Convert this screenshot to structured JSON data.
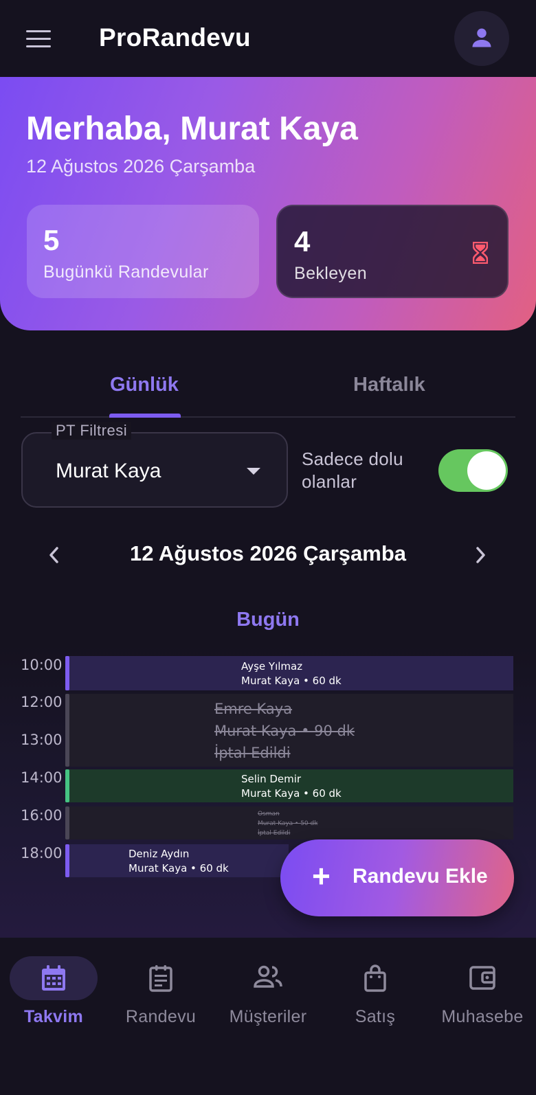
{
  "app": {
    "title": "ProRandevu",
    "menu_icon": "hamburger-menu-icon",
    "profile_icon": "person-icon"
  },
  "hero": {
    "greeting": "Merhaba, Murat Kaya",
    "date": "12 Ağustos 2026 Çarşamba",
    "stats": [
      {
        "value": "5",
        "label": "Bugünkü Randevular"
      },
      {
        "value": "4",
        "label": "Bekleyen",
        "icon": "hourglass-icon"
      }
    ]
  },
  "tabs": [
    {
      "label": "Günlük",
      "active": true
    },
    {
      "label": "Haftalık",
      "active": false
    }
  ],
  "filter": {
    "legend": "PT Filtresi",
    "value": "Murat Kaya"
  },
  "toggle": {
    "label": "Sadece dolu olanlar",
    "on": true
  },
  "date_nav": {
    "date": "12 Ağustos 2026 Çarşamba",
    "today_label": "Bugün"
  },
  "calendar": {
    "times": [
      "10:00",
      "12:00",
      "13:00",
      "14:00",
      "16:00",
      "18:00"
    ],
    "events": [
      {
        "name": "Ayşe Yılmaz",
        "detail": "Murat Kaya • 60 dk",
        "status": ""
      },
      {
        "name": "Emre Kaya",
        "detail": "Murat Kaya • 90 dk",
        "status": "İptal Edildi"
      },
      {
        "name": "Selin Demir",
        "detail": "Murat Kaya • 60 dk",
        "status": ""
      },
      {
        "name": "Osman",
        "detail": "Murat Kaya • 50 dk",
        "status": "İptal Edildi"
      },
      {
        "name": "Deniz Aydın",
        "detail": "Murat Kaya • 60 dk",
        "status": ""
      }
    ]
  },
  "fab": {
    "label": "Randevu Ekle",
    "icon": "plus-icon"
  },
  "bottom_nav": [
    {
      "label": "Takvim",
      "icon": "calendar-icon",
      "active": true
    },
    {
      "label": "Randevu",
      "icon": "document-list-icon",
      "active": false
    },
    {
      "label": "Müşteriler",
      "icon": "people-icon",
      "active": false
    },
    {
      "label": "Satış",
      "icon": "shopping-bag-icon",
      "active": false
    },
    {
      "label": "Muhasebe",
      "icon": "wallet-icon",
      "active": false
    }
  ],
  "colors": {
    "background": "#15121f",
    "accent": "#7d5cf0",
    "toggle_on": "#66c75f",
    "confirmed": "#45c383",
    "pending_icon": "#ff5a6e"
  }
}
